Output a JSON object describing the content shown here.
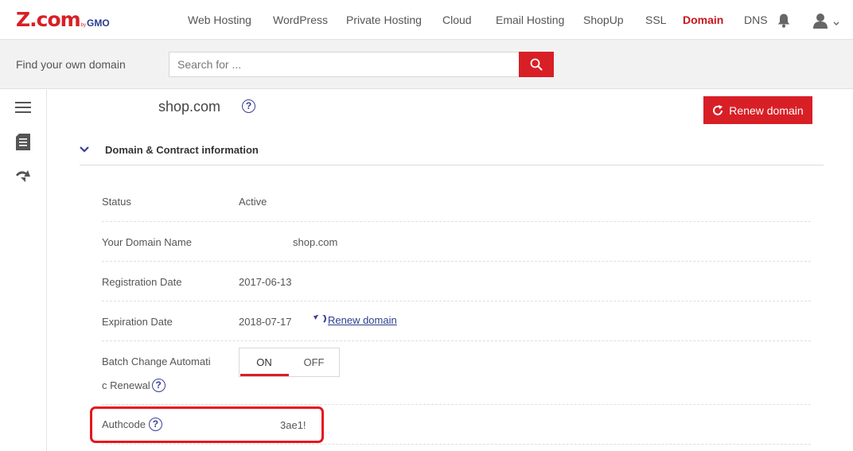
{
  "header": {
    "logo_main": "Z.com",
    "logo_by": "by",
    "logo_gmo": "GMO",
    "nav": [
      {
        "label": "Web Hosting"
      },
      {
        "label": "WordPress"
      },
      {
        "label": "Private Hosting"
      },
      {
        "label": "Cloud"
      },
      {
        "label": "Email Hosting"
      },
      {
        "label": "ShopUp"
      },
      {
        "label": "SSL"
      },
      {
        "label": "Domain"
      },
      {
        "label": "DNS"
      }
    ],
    "active_nav": "Domain",
    "icons": [
      "bell-icon",
      "user-icon",
      "chevron-down-icon"
    ]
  },
  "search": {
    "label": "Find your own domain",
    "placeholder": "Search for ...",
    "button_icon": "search-icon"
  },
  "sidebar": {
    "icons": [
      "menu-icon",
      "document-icon",
      "renew-arrow-icon"
    ]
  },
  "domain": {
    "name": "shop.com",
    "help_glyph": "?",
    "renew_button_label": "Renew domain",
    "renew_icon": "refresh-icon"
  },
  "section": {
    "title": "Domain & Contract information",
    "chevron_icon": "chevron-down-icon"
  },
  "fields": {
    "status": {
      "label": "Status",
      "value": "Active"
    },
    "domain_name": {
      "label": "Your Domain Name",
      "value": "shop.com"
    },
    "registration": {
      "label": "Registration Date",
      "value": "2017-06-13"
    },
    "expiration": {
      "label": "Expiration Date",
      "value": "2018-07-17",
      "link": "Renew domain"
    },
    "auto_renewal": {
      "label_line1": "Batch Change Automati",
      "label_line2": "c Renewal",
      "on_label": "ON",
      "off_label": "OFF",
      "selected": "ON"
    },
    "authcode": {
      "label": "Authcode",
      "value": "3ae1!"
    }
  },
  "colors": {
    "brand_red": "#d81f26",
    "brand_blue": "#2a3b8f",
    "highlight": "#e8141c"
  }
}
